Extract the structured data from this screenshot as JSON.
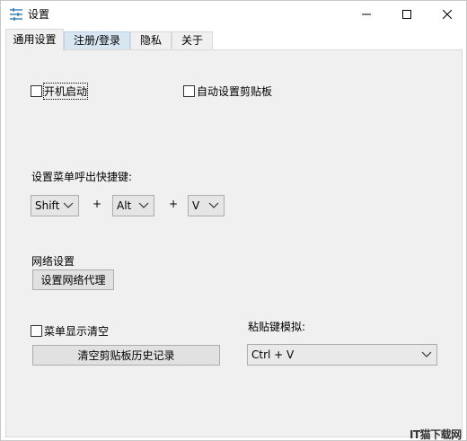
{
  "window": {
    "title": "设置",
    "icon": "settings-sliders-icon",
    "controls": {
      "minimize": "minimize-icon",
      "maximize": "maximize-icon",
      "close": "close-icon"
    }
  },
  "tabs": [
    {
      "label": "通用设置",
      "active": true
    },
    {
      "label": "注册/登录",
      "active": false
    },
    {
      "label": "隐私",
      "active": false
    },
    {
      "label": "关于",
      "active": false
    }
  ],
  "general": {
    "autostart": {
      "label": "开机启动",
      "checked": false
    },
    "auto_clipboard": {
      "label": "自动设置剪贴板",
      "checked": false
    },
    "hotkey": {
      "label": "设置菜单呼出快捷键:",
      "key1": "Shift",
      "plus1": "+",
      "key2": "Alt",
      "plus2": "+",
      "key3": "V"
    },
    "network": {
      "label": "网络设置",
      "proxy_button": "设置网络代理"
    },
    "menu_clear": {
      "label": "菜单显示清空",
      "checked": false
    },
    "clear_history_button": "清空剪贴板历史记录",
    "paste_key": {
      "label": "粘贴键模拟:",
      "value": "Ctrl + V"
    }
  },
  "watermark": "IT猫下载网"
}
